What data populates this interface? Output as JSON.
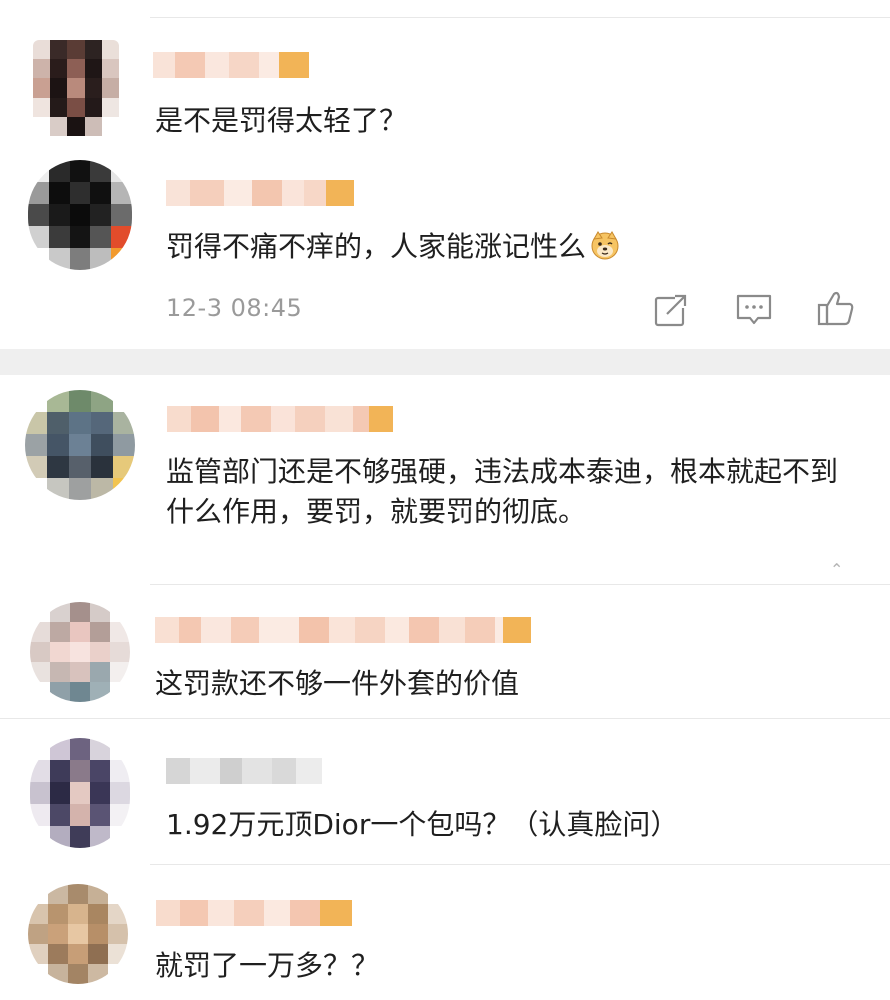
{
  "comments": [
    {
      "text": "是不是罚得太轻了？",
      "reply": {
        "text": "罚得不痛不痒的，人家能涨记性么",
        "emoji": "doge-face-icon",
        "timestamp": "12-3 08:45",
        "actions": [
          "share-icon",
          "comment-icon",
          "like-icon"
        ]
      }
    },
    {
      "text": "监管部门还是不够强硬，违法成本泰迪，根本就起不到什么作用，要罚，就要罚的彻底。",
      "collapse_mark": "⌃"
    },
    {
      "text": "这罚款还不够一件外套的价值"
    },
    {
      "text": "1.92万元顶Dior一个包吗？（认真脸问）"
    },
    {
      "text": "就罚了一万多？？"
    }
  ],
  "colors": {
    "text": "#1f1f1f",
    "meta": "#9a9a9a",
    "divider": "#e8e8e8",
    "section_bg": "#efefef",
    "mosaic_light": "#f6d2bf",
    "mosaic_accent": "#f2b457",
    "icon": "#8a8a8a"
  }
}
